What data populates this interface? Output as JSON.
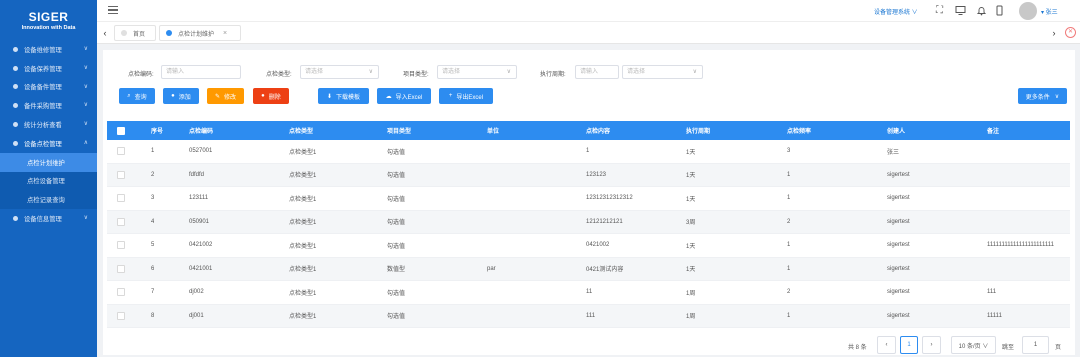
{
  "brand": {
    "title": "SIGER",
    "subtitle": "Innovation with Data"
  },
  "menu": [
    {
      "label": "设备维修管理"
    },
    {
      "label": "设备保养管理"
    },
    {
      "label": "设备备件管理"
    },
    {
      "label": "备件采购管理"
    },
    {
      "label": "统计分析查看"
    },
    {
      "label": "设备点检管理"
    },
    {
      "label": "点检计划维护"
    },
    {
      "label": "点检设备管理"
    },
    {
      "label": "点检记录查询"
    },
    {
      "label": "设备信息管理"
    }
  ],
  "topbar": {
    "system_menu": "设备管理系统 ∨",
    "user_name": "▾ 张三"
  },
  "tabs": [
    {
      "label": "首页",
      "dot_color": "#e0e0e0"
    },
    {
      "label": "点检计划维护",
      "dot_color": "#2d8cf0"
    }
  ],
  "filters": {
    "code": {
      "label": "点检编码:",
      "placeholder": "请输入"
    },
    "type": {
      "label": "点检类型:",
      "placeholder": "请选择"
    },
    "item_type": {
      "label": "项目类型:",
      "placeholder": "请选择"
    },
    "period": {
      "label": "执行周期:",
      "placeholder": "请输入",
      "unit_placeholder": "请选择"
    }
  },
  "buttons": {
    "search": "查询",
    "add": "添加",
    "edit": "修改",
    "delete": "删除",
    "download_template": "下载模板",
    "import_excel": "导入Excel",
    "export_excel": "导出Excel",
    "more_conditions": "更多条件"
  },
  "table": {
    "headers": [
      "序号",
      "点检编码",
      "点检类型",
      "项目类型",
      "单位",
      "点检内容",
      "执行周期",
      "点检频率",
      "创建人",
      "备注"
    ],
    "rows": [
      [
        "1",
        "0527001",
        "点检类型1",
        "勾选值",
        "",
        "1",
        "1天",
        "3",
        "张三",
        ""
      ],
      [
        "2",
        "fdfdfd",
        "点检类型1",
        "勾选值",
        "",
        "123123",
        "1天",
        "1",
        "sigertest",
        ""
      ],
      [
        "3",
        "123111",
        "点检类型1",
        "勾选值",
        "",
        "12312312312312",
        "1天",
        "1",
        "sigertest",
        ""
      ],
      [
        "4",
        "050901",
        "点检类型1",
        "勾选值",
        "",
        "12121212121",
        "3周",
        "2",
        "sigertest",
        ""
      ],
      [
        "5",
        "0421002",
        "点检类型1",
        "勾选值",
        "",
        "0421002",
        "1天",
        "1",
        "sigertest",
        "11111111111111111111111"
      ],
      [
        "6",
        "0421001",
        "点检类型1",
        "数值型",
        "par",
        "0421测试内容",
        "1天",
        "1",
        "sigertest",
        ""
      ],
      [
        "7",
        "dj002",
        "点检类型1",
        "勾选值",
        "",
        "11",
        "1周",
        "2",
        "sigertest",
        "111"
      ],
      [
        "8",
        "dj001",
        "点检类型1",
        "勾选值",
        "",
        "111",
        "1周",
        "1",
        "sigertest",
        "11111"
      ]
    ]
  },
  "pagination": {
    "total": "共 8 条",
    "prev": "‹",
    "current_page": "1",
    "next": "›",
    "page_size": "10 条/页 ∨",
    "goto_label": "跳至",
    "goto_value": "1",
    "page_suffix": "页"
  }
}
